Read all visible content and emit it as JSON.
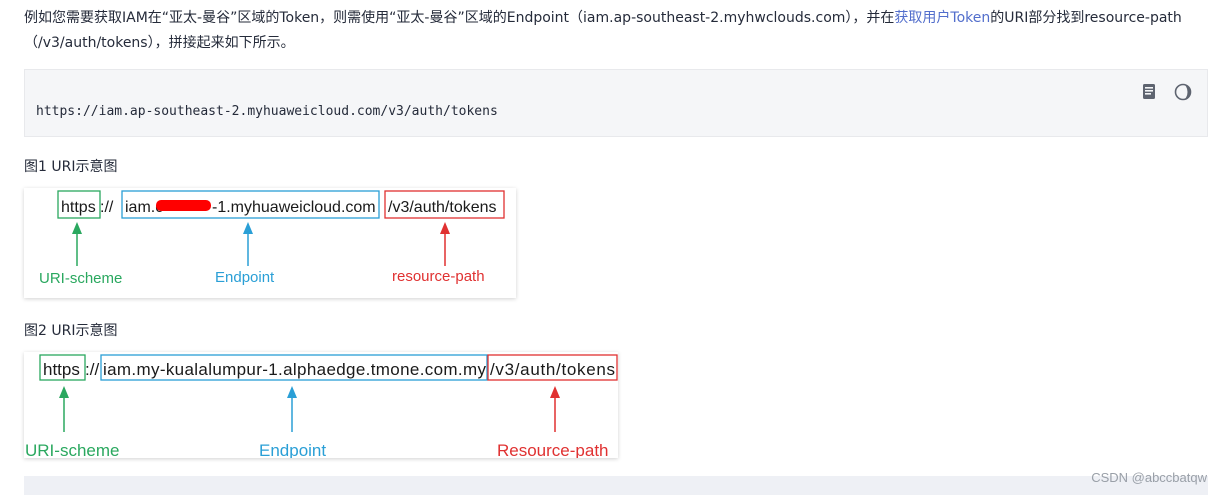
{
  "intro": {
    "part1": "例如您需要获取IAM在“亚太-曼谷”区域的Token，则需使用“亚太-曼谷”区域的Endpoint（iam.ap-southeast-2.myhwclouds.com），并在",
    "link": "获取用户Token",
    "part2": "的URI部分找到resource-path（/v3/auth/tokens），拼接起来如下所示。"
  },
  "code": {
    "text": "https://iam.ap-southeast-2.myhuaweicloud.com/v3/auth/tokens",
    "copy_icon": "copy-icon",
    "theme_icon": "theme-toggle-icon"
  },
  "figure1": {
    "caption": "图1 URI示意图",
    "scheme": "https",
    "separator": "://",
    "endpoint": "iam.c",
    "endpoint_tail": "-1.myhuaweicloud.com",
    "path": "/v3/auth/tokens",
    "label_scheme": "URI-scheme",
    "label_endpoint": "Endpoint",
    "label_path": "resource-path",
    "color_scheme": "#2aa85f",
    "color_endpoint": "#2a9fd6",
    "color_path": "#e03131",
    "redaction_color": "#ff0000"
  },
  "figure2": {
    "caption": "图2 URI示意图",
    "scheme": "https",
    "separator": "://",
    "endpoint": "iam.my-kualalumpur-1.alphaedge.tmone.com.my",
    "path": "/v3/auth/tokens",
    "label_scheme": "URI-scheme",
    "label_endpoint": "Endpoint",
    "label_path": "Resource-path",
    "color_scheme": "#2aa85f",
    "color_endpoint": "#2a9fd6",
    "color_path": "#e03131"
  },
  "watermark": "CSDN @abccbatqw"
}
